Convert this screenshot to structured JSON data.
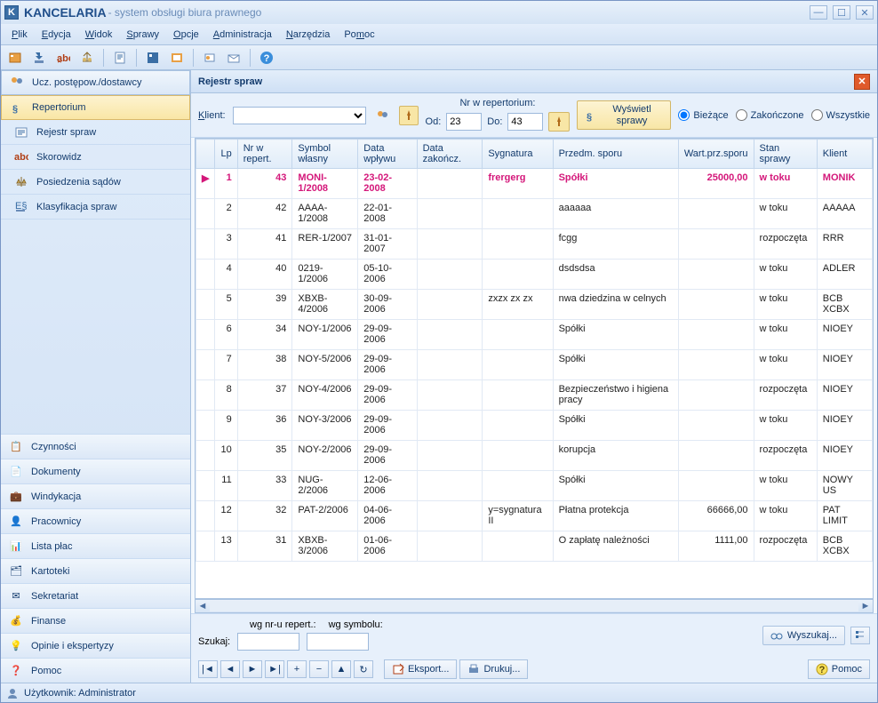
{
  "window": {
    "title": "KANCELARIA",
    "subtitle": "- system obsługi biura prawnego"
  },
  "menu": [
    "Plik",
    "Edycja",
    "Widok",
    "Sprawy",
    "Opcje",
    "Administracja",
    "Narzędzia",
    "Pomoc"
  ],
  "sidebar_top_header": "Ucz. postępow./dostawcy",
  "sidebar_items": [
    {
      "label": "Repertorium",
      "active": true
    },
    {
      "label": "Rejestr spraw",
      "sub": true
    },
    {
      "label": "Skorowidz",
      "sub": true
    },
    {
      "label": "Posiedzenia sądów",
      "sub": true
    },
    {
      "label": "Klasyfikacja spraw",
      "sub": true
    }
  ],
  "sidebar_bottom": [
    "Czynności",
    "Dokumenty",
    "Windykacja",
    "Pracownicy",
    "Lista płac",
    "Kartoteki",
    "Sekretariat",
    "Finanse",
    "Opinie i ekspertyzy",
    "Pomoc"
  ],
  "panel": {
    "title": "Rejestr spraw"
  },
  "filter": {
    "client_label": "Klient:",
    "nr_label": "Nr w repertorium:",
    "od_label": "Od:",
    "do_label": "Do:",
    "od": "23",
    "do": "43",
    "btn_show": "Wyświetl sprawy",
    "opt_current": "Bieżące",
    "opt_closed": "Zakończone",
    "opt_all": "Wszystkie"
  },
  "columns": [
    "Lp",
    "Nr w repert.",
    "Symbol własny",
    "Data wpływu",
    "Data zakończ.",
    "Sygnatura",
    "Przedm. sporu",
    "Wart.prz.sporu",
    "Stan sprawy",
    "Klient"
  ],
  "rows": [
    {
      "lp": "1",
      "nr": "43",
      "symbol": "MONI-1/2008",
      "wplyw": "23-02-2008",
      "zak": "",
      "syg": "frergerg",
      "przedm": "Spółki",
      "wart": "25000,00",
      "stan": "w toku",
      "klient": "MONIK",
      "sel": true
    },
    {
      "lp": "2",
      "nr": "42",
      "symbol": "AAAA-1/2008",
      "wplyw": "22-01-2008",
      "zak": "",
      "syg": "",
      "przedm": "aaaaaa",
      "wart": "",
      "stan": "w toku",
      "klient": "AAAAA"
    },
    {
      "lp": "3",
      "nr": "41",
      "symbol": "RER-1/2007",
      "wplyw": "31-01-2007",
      "zak": "",
      "syg": "",
      "przedm": "fcgg",
      "wart": "",
      "stan": "rozpoczęta",
      "klient": "RRR"
    },
    {
      "lp": "4",
      "nr": "40",
      "symbol": "0219-1/2006",
      "wplyw": "05-10-2006",
      "zak": "",
      "syg": "",
      "przedm": "dsdsdsa",
      "wart": "",
      "stan": "w toku",
      "klient": "ADLER"
    },
    {
      "lp": "5",
      "nr": "39",
      "symbol": "XBXB-4/2006",
      "wplyw": "30-09-2006",
      "zak": "",
      "syg": "zxzx zx zx",
      "przedm": "nwa dziedzina w celnych",
      "wart": "",
      "stan": "w toku",
      "klient": "BCB XCBX"
    },
    {
      "lp": "6",
      "nr": "34",
      "symbol": "NOY-1/2006",
      "wplyw": "29-09-2006",
      "zak": "",
      "syg": "",
      "przedm": "Spółki",
      "wart": "",
      "stan": "w toku",
      "klient": "NIOEY"
    },
    {
      "lp": "7",
      "nr": "38",
      "symbol": "NOY-5/2006",
      "wplyw": "29-09-2006",
      "zak": "",
      "syg": "",
      "przedm": "Spółki",
      "wart": "",
      "stan": "w toku",
      "klient": "NIOEY"
    },
    {
      "lp": "8",
      "nr": "37",
      "symbol": "NOY-4/2006",
      "wplyw": "29-09-2006",
      "zak": "",
      "syg": "",
      "przedm": "Bezpieczeństwo i higiena pracy",
      "wart": "",
      "stan": "rozpoczęta",
      "klient": "NIOEY"
    },
    {
      "lp": "9",
      "nr": "36",
      "symbol": "NOY-3/2006",
      "wplyw": "29-09-2006",
      "zak": "",
      "syg": "",
      "przedm": "Spółki",
      "wart": "",
      "stan": "w toku",
      "klient": "NIOEY"
    },
    {
      "lp": "10",
      "nr": "35",
      "symbol": "NOY-2/2006",
      "wplyw": "29-09-2006",
      "zak": "",
      "syg": "",
      "przedm": "korupcja",
      "wart": "",
      "stan": "rozpoczęta",
      "klient": "NIOEY"
    },
    {
      "lp": "11",
      "nr": "33",
      "symbol": "NUG-2/2006",
      "wplyw": "12-06-2006",
      "zak": "",
      "syg": "",
      "przedm": "Spółki",
      "wart": "",
      "stan": "w toku",
      "klient": "NOWY US"
    },
    {
      "lp": "12",
      "nr": "32",
      "symbol": "PAT-2/2006",
      "wplyw": "04-06-2006",
      "zak": "",
      "syg": "y=sygnatura II",
      "przedm": "Płatna protekcja",
      "wart": "66666,00",
      "stan": "w toku",
      "klient": "PAT LIMIT"
    },
    {
      "lp": "13",
      "nr": "31",
      "symbol": "XBXB-3/2006",
      "wplyw": "01-06-2006",
      "zak": "",
      "syg": "",
      "przedm": "O zapłatę należności",
      "wart": "1111,00",
      "stan": "rozpoczęta",
      "klient": "BCB XCBX"
    }
  ],
  "search": {
    "lbl_nr": "wg nr-u repert.:",
    "lbl_sym": "wg symbolu:",
    "label": "Szukaj:",
    "btn": "Wyszukaj..."
  },
  "bottom": {
    "export": "Eksport...",
    "print": "Drukuj...",
    "help": "Pomoc"
  },
  "status": {
    "user": "Użytkownik: Administrator"
  }
}
